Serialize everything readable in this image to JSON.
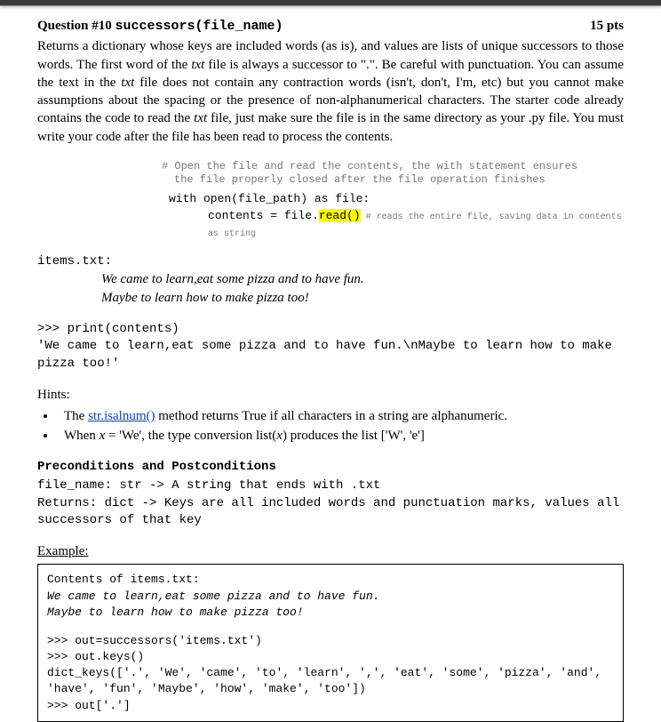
{
  "header": {
    "question_num": "Question #10",
    "func_sig": "successors(file_name)",
    "points": "15 pts"
  },
  "description": "Returns a dictionary whose keys are included words (as is), and values are lists of unique successors to those words. The first word of the txt file is always a successor to \".\". Be careful with punctuation. You can assume the text in the txt file does not contain any contraction words (isn't, don't, I'm, etc) but you cannot make assumptions about the spacing or the presence of non-alphanumerical characters. The starter code already contains the code to read the txt file, just make sure the file is in the same directory as your .py file. You must write your code after the file has been read to process the contents.",
  "code_comment": {
    "line1": "# Open the file and read the contents, the with statement ensures",
    "line2": "the file properly closed after the file operation finishes"
  },
  "code_open": {
    "with_line": "with open(file_path) as file:",
    "contents_pre": "contents = file.",
    "read_call": "read()",
    "after_cmt": " # reads the entire file, saving data in contents as string"
  },
  "items": {
    "label": "items.txt:",
    "line1": "We came to learn,eat some pizza and to have fun.",
    "line2": "Maybe to learn how to make pizza too!"
  },
  "print_block": {
    "cmd": ">>> print(contents)",
    "out": "'We came to learn,eat some pizza and to have fun.\\nMaybe to learn how to make pizza too!'"
  },
  "hints": {
    "label": "Hints:",
    "items": [
      {
        "pre": "The ",
        "link": "str.isalnum()",
        "post": " method returns True if all characters in a string are alphanumeric."
      },
      {
        "text": "When x = 'We', the type conversion list(x) produces the list ['W', 'e']"
      }
    ]
  },
  "precond": {
    "title": "Preconditions and Postconditions",
    "line1": "file_name: str -> A string that ends with .txt",
    "line2": "Returns: dict -> Keys are all included words and punctuation marks, values all successors of that key"
  },
  "example": {
    "label": "Example:",
    "contents_label": "Contents of items.txt:",
    "file_line1": "We came to learn,eat some pizza and to have fun.",
    "file_line2": "Maybe to learn how to make pizza too!",
    "cmd1": ">>> out=successors('items.txt')",
    "cmd2": ">>> out.keys()",
    "keys_out": "dict_keys(['.', 'We', 'came', 'to', 'learn', ',', 'eat', 'some', 'pizza', 'and', 'have', 'fun', 'Maybe', 'how', 'make', 'too'])",
    "cmd3": ">>> out['.']"
  }
}
